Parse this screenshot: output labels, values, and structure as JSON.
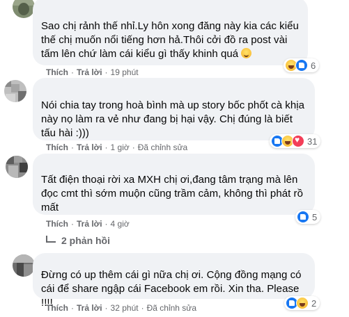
{
  "comments": [
    {
      "text": "Sao chị rảnh thế nhỉ.Ly hôn xong đăng này kia các kiểu\nthế chị muốn nổi tiếng hơn hả.Thôi cởi đồ ra post vài\ntấm lên chứ làm cái kiểu gì thấy khinh quá",
      "emoji": "smile-emoji",
      "actions": {
        "like": "Thích",
        "reply": "Trả lời",
        "time": "19 phút"
      },
      "reactions": {
        "icons": [
          "haha",
          "like"
        ],
        "count": "6"
      }
    },
    {
      "text": "Nói chia tay trong hoà bình mà up story bốc phốt cà khịa\nnày nọ làm ra vẻ như đang bị hại vậy. Chị đúng là biết\ntấu hài :)))",
      "actions": {
        "like": "Thích",
        "reply": "Trả lời",
        "time": "1 giờ",
        "edited": "Đã chỉnh sửa"
      },
      "reactions": {
        "icons": [
          "like",
          "haha",
          "love"
        ],
        "count": "31"
      }
    },
    {
      "text": "Tất điện thoại rời xa MXH chị ơi,đang tâm trạng mà lên\nđọc cmt thì sớm muộn cũng trầm cảm, không thì phát rồ\nmất",
      "actions": {
        "like": "Thích",
        "reply": "Trả lời",
        "time": "4 giờ"
      },
      "reactions": {
        "icons": [
          "like"
        ],
        "count": "5"
      },
      "replies_label": "2 phản hồi"
    },
    {
      "text": "Đừng có up thêm cái gì nữa chị ơi. Cộng đồng mạng có\ncái để share ngập cái Facebook em rồi. Xin tha. Please !!!!",
      "actions": {
        "like": "Thích",
        "reply": "Trả lời",
        "time": "32 phút",
        "edited": "Đã chỉnh sửa"
      },
      "reactions": {
        "icons": [
          "like",
          "haha"
        ],
        "count": "2"
      }
    }
  ],
  "separator": "·"
}
